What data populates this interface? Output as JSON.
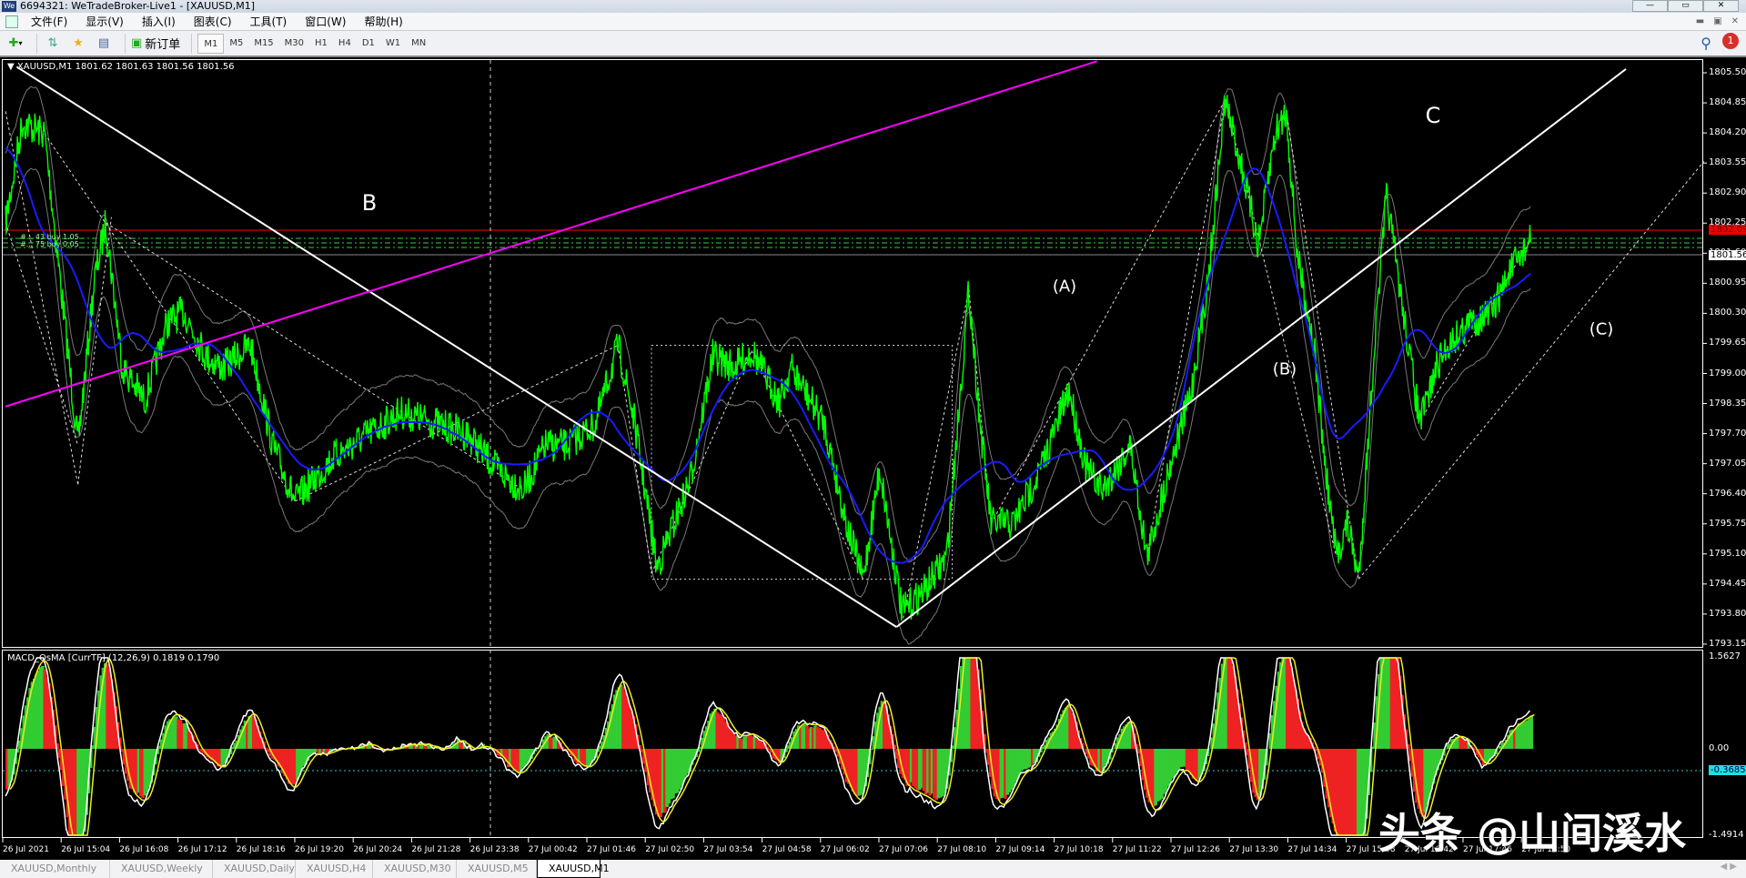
{
  "window": {
    "title": "6694321: WeTradeBroker-Live1 - [XAUUSD,M1]",
    "logo": "We"
  },
  "menu": [
    "文件(F)",
    "显示(V)",
    "插入(I)",
    "图表(C)",
    "工具(T)",
    "窗口(W)",
    "帮助(H)"
  ],
  "toolbar": {
    "new_order": "新订单",
    "timeframes": [
      "M1",
      "M5",
      "M15",
      "M30",
      "H1",
      "H4",
      "D1",
      "W1",
      "MN"
    ],
    "active_timeframe": "M1",
    "notification_count": "1"
  },
  "chart": {
    "header": "XAUUSD,M1  1801.62 1801.63 1801.56 1801.56",
    "price_axis": [
      "1805.50",
      "1804.85",
      "1804.20",
      "1803.55",
      "1802.90",
      "1802.25",
      "1801.60",
      "1800.95",
      "1800.30",
      "1799.65",
      "1799.00",
      "1798.35",
      "1797.70",
      "1797.05",
      "1796.40",
      "1795.75",
      "1795.10",
      "1794.45",
      "1793.80",
      "1793.15"
    ],
    "ask_label": "1802.09",
    "bid_label": "1801.56",
    "order_labels": [
      "#... 43 buy 1.05",
      "#... 75 buy 0.05"
    ],
    "wave_labels": {
      "B": "B",
      "C": "C",
      "A_paren": "(A)",
      "B_paren": "(B)",
      "C_paren": "(C)"
    },
    "colors": {
      "price": "#00ff00",
      "ma": "#1a1aff",
      "trend_magenta": "#ff00ff",
      "ask": "#ff0000"
    }
  },
  "macd": {
    "header": "MACD_OsMA [CurrTF] (12,26,9) 0.1819 0.1790",
    "axis": {
      "top": "1.5627",
      "zero": "0.00",
      "current": "-0.3685",
      "bottom": "-1.4914"
    }
  },
  "time_axis": [
    "26 Jul 2021",
    "26 Jul 15:04",
    "26 Jul 16:08",
    "26 Jul 17:12",
    "26 Jul 18:16",
    "26 Jul 19:20",
    "26 Jul 20:24",
    "26 Jul 21:28",
    "26 Jul 23:38",
    "27 Jul 00:42",
    "27 Jul 01:46",
    "27 Jul 02:50",
    "27 Jul 03:54",
    "27 Jul 04:58",
    "27 Jul 06:02",
    "27 Jul 07:06",
    "27 Jul 08:10",
    "27 Jul 09:14",
    "27 Jul 10:18",
    "27 Jul 11:22",
    "27 Jul 12:26",
    "27 Jul 13:30",
    "27 Jul 14:34",
    "27 Jul 15:38",
    "27 Jul 16:42",
    "27 Jul 17:46",
    "27 Jul 18:50"
  ],
  "tabs": [
    "XAUUSD,Monthly",
    "XAUUSD,Weekly",
    "XAUUSD,Daily",
    "XAUUSD,H4",
    "XAUUSD,M30",
    "XAUUSD,M5",
    "XAUUSD,M1"
  ],
  "active_tab": "XAUUSD,M1",
  "watermark": "头条 @山间溪水"
}
